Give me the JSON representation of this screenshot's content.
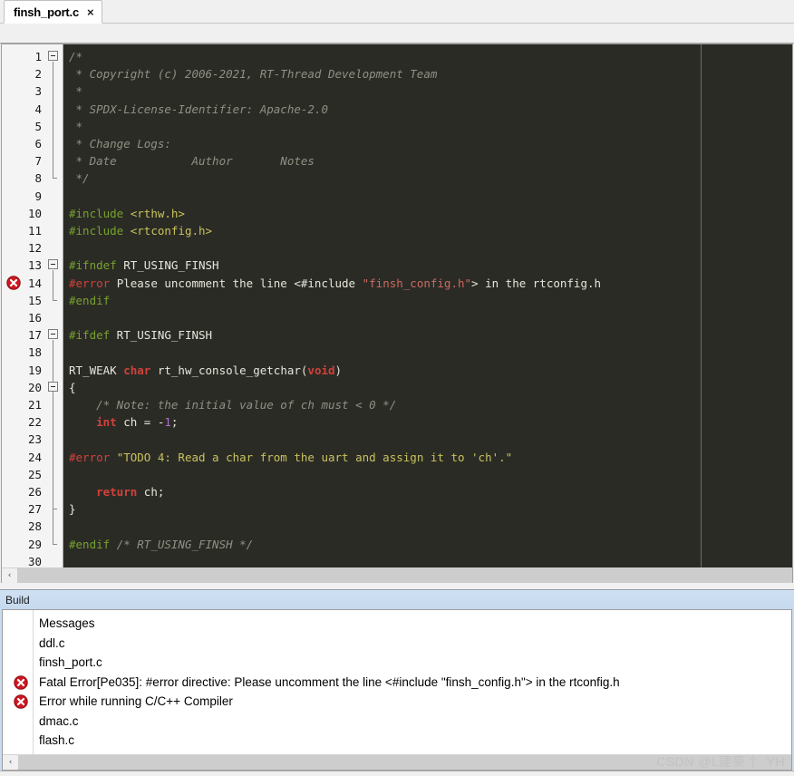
{
  "window": {
    "tab": {
      "label": "finsh_port.c",
      "close_icon": "close-icon",
      "close_glyph": "×"
    }
  },
  "editor": {
    "language": "c",
    "first_visible_line": 1,
    "last_visible_line": 30,
    "total_visible_lines": 30,
    "background_color": "#2b2b26",
    "gutter_background_color": "#f4f4f4",
    "ruler_column_color": "#6e6e64",
    "syntax_colors": {
      "comment": "#8f9183",
      "preprocessor": "#76a22b",
      "error_directive": "#d2413a",
      "string_red": "#cc6a5e",
      "string_yellow": "#c8c25c",
      "keyword": "#d2413a",
      "number": "#b46fce",
      "plain": "#e6e6dc"
    },
    "lines": [
      {
        "n": 1,
        "text": "/*"
      },
      {
        "n": 2,
        "text": " * Copyright (c) 2006-2021, RT-Thread Development Team"
      },
      {
        "n": 3,
        "text": " *"
      },
      {
        "n": 4,
        "text": " * SPDX-License-Identifier: Apache-2.0"
      },
      {
        "n": 5,
        "text": " *"
      },
      {
        "n": 6,
        "text": " * Change Logs:"
      },
      {
        "n": 7,
        "text": " * Date           Author       Notes"
      },
      {
        "n": 8,
        "text": " */"
      },
      {
        "n": 9,
        "text": ""
      },
      {
        "n": 10,
        "text": "#include <rthw.h>"
      },
      {
        "n": 11,
        "text": "#include <rtconfig.h>"
      },
      {
        "n": 12,
        "text": ""
      },
      {
        "n": 13,
        "text": "#ifndef RT_USING_FINSH"
      },
      {
        "n": 14,
        "text": "#error Please uncomment the line <#include \"finsh_config.h\"> in the rtconfig.h"
      },
      {
        "n": 15,
        "text": "#endif"
      },
      {
        "n": 16,
        "text": ""
      },
      {
        "n": 17,
        "text": "#ifdef RT_USING_FINSH"
      },
      {
        "n": 18,
        "text": ""
      },
      {
        "n": 19,
        "text": "RT_WEAK char rt_hw_console_getchar(void)"
      },
      {
        "n": 20,
        "text": "{"
      },
      {
        "n": 21,
        "text": "    /* Note: the initial value of ch must < 0 */"
      },
      {
        "n": 22,
        "text": "    int ch = -1;"
      },
      {
        "n": 23,
        "text": ""
      },
      {
        "n": 24,
        "text": "#error \"TODO 4: Read a char from the uart and assign it to 'ch'.\""
      },
      {
        "n": 25,
        "text": ""
      },
      {
        "n": 26,
        "text": "    return ch;"
      },
      {
        "n": 27,
        "text": "}"
      },
      {
        "n": 28,
        "text": ""
      },
      {
        "n": 29,
        "text": "#endif /* RT_USING_FINSH */"
      },
      {
        "n": 30,
        "text": ""
      }
    ],
    "error_marker_lines": [
      14
    ],
    "fold_start_lines": [
      1,
      13,
      17,
      20
    ],
    "scrollbar": {
      "left_arrow_glyph": "‹",
      "icon": "scroll-left-icon"
    }
  },
  "build_panel": {
    "title": "Build",
    "column_header": "Messages",
    "rows": [
      {
        "text": "Messages",
        "error": false,
        "header": true
      },
      {
        "text": "ddl.c",
        "error": false
      },
      {
        "text": "finsh_port.c",
        "error": false
      },
      {
        "text": "Fatal Error[Pe035]: #error directive: Please uncomment the line <#include \"finsh_config.h\"> in the rtconfig.h",
        "error": true
      },
      {
        "text": "Error while running C/C++ Compiler",
        "error": true
      },
      {
        "text": "dmac.c",
        "error": false
      },
      {
        "text": "flash.c",
        "error": false
      }
    ],
    "scrollbar": {
      "left_arrow_glyph": "‹",
      "icon": "scroll-left-icon"
    }
  },
  "watermark": {
    "text": "CSDN @L建豪 忄 YH"
  }
}
